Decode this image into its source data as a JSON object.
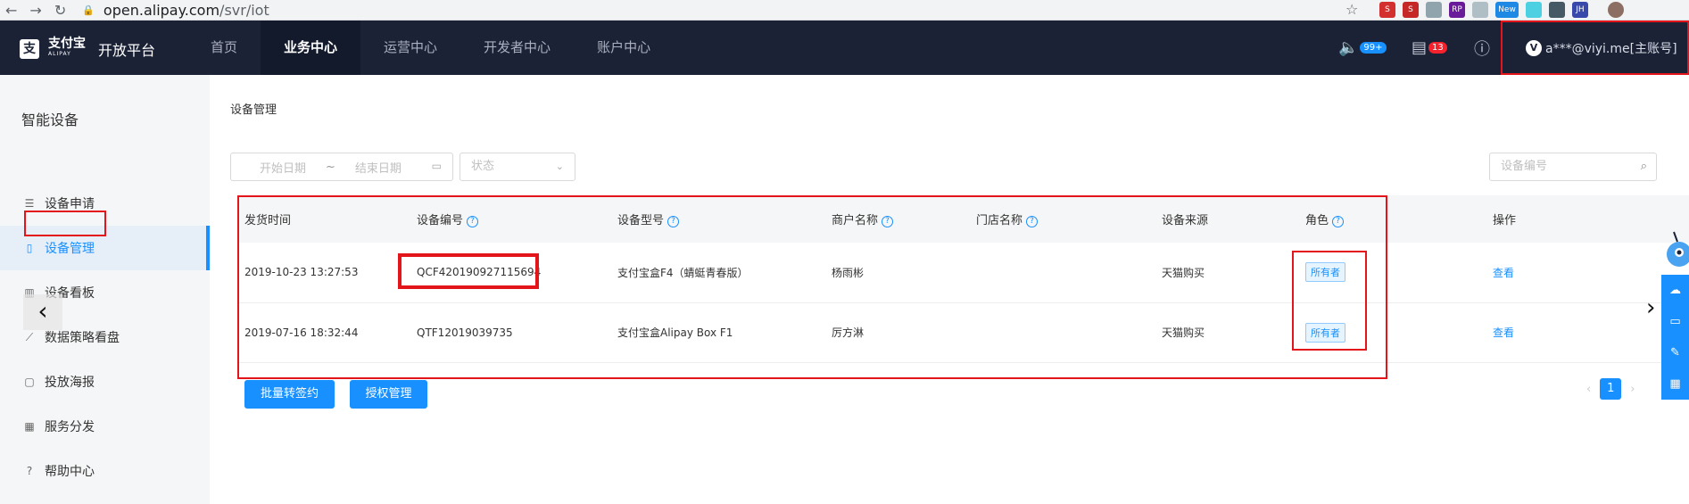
{
  "browser": {
    "url_host": "open.alipay.com",
    "url_path": "/svr/iot",
    "ext_badges": [
      "S",
      "S",
      "RP",
      "New",
      "JH"
    ]
  },
  "header": {
    "logo_cn": "支付宝",
    "logo_en": "ALIPAY",
    "platform": "开放平台",
    "menu": [
      "首页",
      "业务中心",
      "运营中心",
      "开发者中心",
      "账户中心"
    ],
    "active_menu": "业务中心",
    "notice_badge": "99+",
    "task_badge": "13",
    "account": "a***@viyi.me[主账号]",
    "avatar_letter": "V"
  },
  "sidebar": {
    "title": "智能设备",
    "items": [
      {
        "label": "设备申请",
        "icon": "list-icon"
      },
      {
        "label": "设备管理",
        "icon": "device-icon"
      },
      {
        "label": "设备看板",
        "icon": "bar-chart-icon"
      },
      {
        "label": "数据策略看盘",
        "icon": "line-chart-icon"
      },
      {
        "label": "投放海报",
        "icon": "poster-icon"
      },
      {
        "label": "服务分发",
        "icon": "grid-icon"
      },
      {
        "label": "帮助中心",
        "icon": "help-icon"
      }
    ]
  },
  "main": {
    "breadcrumb": "设备管理",
    "start_date_placeholder": "开始日期",
    "date_sep": "~",
    "end_date_placeholder": "结束日期",
    "status_placeholder": "状态",
    "search_placeholder": "设备编号",
    "columns": [
      "发货时间",
      "设备编号",
      "设备型号",
      "商户名称",
      "门店名称",
      "设备来源",
      "角色",
      "操作"
    ],
    "rows": [
      {
        "time": "2019-10-23 13:27:53",
        "device_no": "QCF420190927115694",
        "model": "支付宝盒F4（蜻蜓青春版）",
        "merchant": "杨雨彬",
        "store": "",
        "source": "天猫购买",
        "role": "所有者",
        "action": "查看"
      },
      {
        "time": "2019-07-16 18:32:44",
        "device_no": "QTF12019039735",
        "model": "支付宝盒Alipay Box F1",
        "merchant": "厉方淋",
        "store": "",
        "source": "天猫购买",
        "role": "所有者",
        "action": "查看"
      }
    ],
    "batch_button": "批量转签约",
    "auth_button": "授权管理",
    "current_page": "1"
  },
  "colors": {
    "nav_bg": "#1b2236",
    "accent": "#1890ff",
    "highlight": "#e4141b"
  }
}
